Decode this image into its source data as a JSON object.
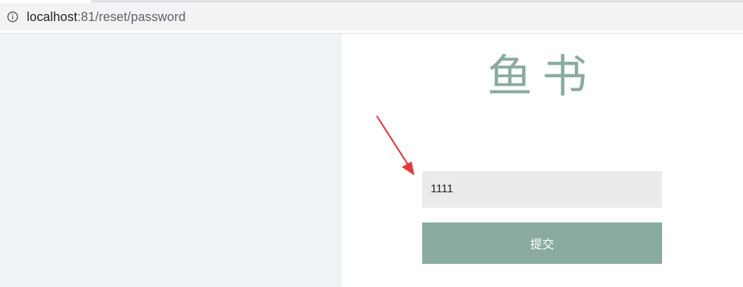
{
  "browser": {
    "url_host": "localhost",
    "url_rest": ":81/reset/password"
  },
  "page": {
    "title": "鱼书",
    "code_input_value": "1111",
    "submit_label": "提交"
  },
  "colors": {
    "accent": "#8aaca0",
    "annotation_arrow": "#e53935",
    "left_panel_bg": "#f0f4f7",
    "input_bg": "#ebebeb"
  }
}
